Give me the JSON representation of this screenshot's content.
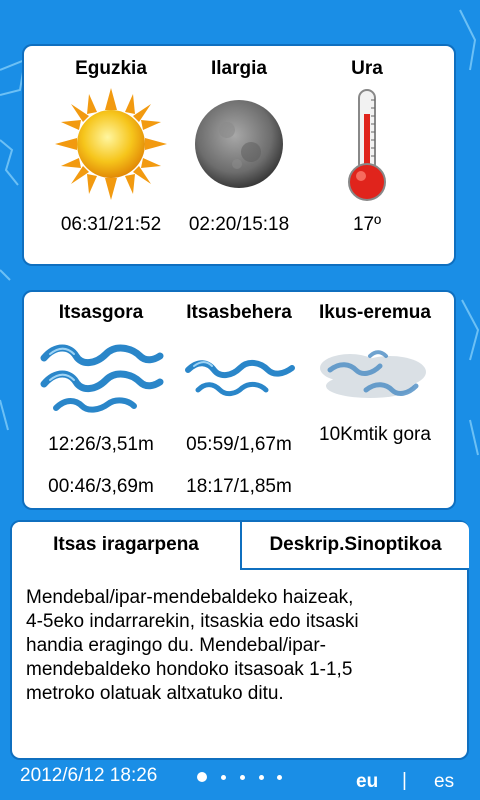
{
  "astro": {
    "sun": {
      "title": "Eguzkia",
      "value": "06:31/21:52",
      "icon": "sun-icon"
    },
    "moon": {
      "title": "Ilargia",
      "value": "02:20/15:18",
      "icon": "moon-icon"
    },
    "water": {
      "title": "Ura",
      "value": "17º",
      "icon": "thermometer-icon"
    }
  },
  "tides": {
    "high": {
      "title": "Itsasgora",
      "values": [
        "12:26/3,51m",
        "00:46/3,69m"
      ],
      "icon": "waves-icon"
    },
    "low": {
      "title": "Itsasbehera",
      "values": [
        "05:59/1,67m",
        "18:17/1,85m"
      ],
      "icon": "waves-icon"
    },
    "visibility": {
      "title": "Ikus-eremua",
      "value": "10Kmtik gora",
      "icon": "fog-icon"
    }
  },
  "forecast": {
    "tabs": [
      {
        "label": "Itsas iragarpena",
        "active": true
      },
      {
        "label": "Deskrip.Sinoptikoa",
        "active": false
      }
    ],
    "text_lines": [
      "Mendebal/ipar-mendebaldeko haizeak,",
      "4-5eko indarrarekin, itsaskia edo itsaski",
      "handia eragingo du. Mendebal/ipar-",
      "mendebaldeko hondoko itsasoak 1-1,5",
      "metroko olatuak altxatuko ditu."
    ]
  },
  "footer": {
    "date": "2012/6/12 18:26",
    "page_count": 5,
    "active_page": 1,
    "lang_eu": "eu",
    "separator": "|",
    "lang_es": "es"
  },
  "colors": {
    "background": "#1a8ee6",
    "panel_border": "#0f6fbf",
    "map_lines": "#6cc0f5"
  }
}
